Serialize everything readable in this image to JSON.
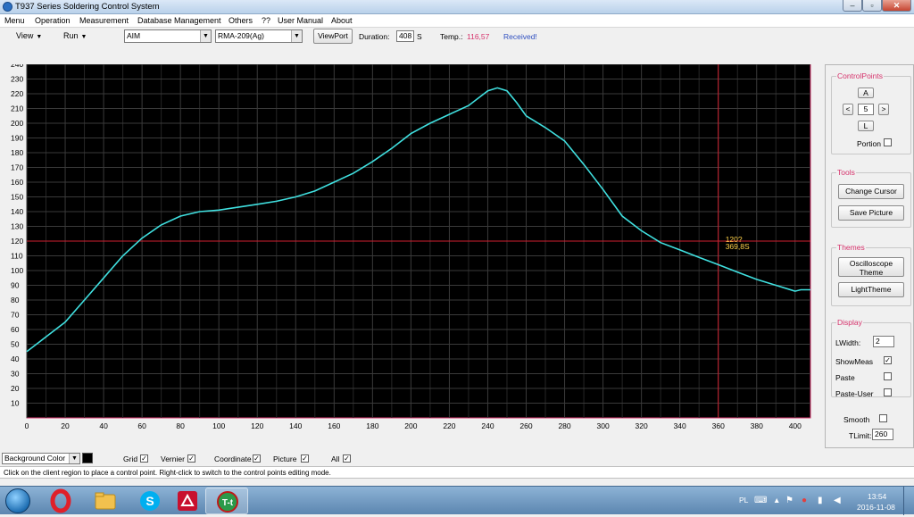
{
  "window": {
    "title": "T937 Series Soldering Control System",
    "min": "–",
    "max": "▫",
    "close": "✕"
  },
  "menu": [
    "Menu",
    "Operation",
    "Measurement",
    "Database Management",
    "Others",
    "??",
    "User Manual",
    "About"
  ],
  "toolbar": {
    "view_label": "View",
    "run_label": "Run",
    "mode_value": "AIM",
    "profile_value": "RMA-209(Ag)",
    "viewport_label": "ViewPort",
    "duration_label": "Duration:",
    "duration_value": "408",
    "duration_unit": "S",
    "temp_label": "Temp.:",
    "temp_value": "116,57",
    "status": "Received!"
  },
  "chart_data": {
    "type": "line",
    "xlim": [
      0,
      408
    ],
    "ylim": [
      0,
      240
    ],
    "xticks": [
      0,
      20,
      40,
      60,
      80,
      100,
      120,
      140,
      160,
      180,
      200,
      220,
      240,
      260,
      280,
      300,
      320,
      340,
      360,
      380,
      400
    ],
    "yticks": [
      10,
      20,
      30,
      40,
      50,
      60,
      70,
      80,
      90,
      100,
      110,
      120,
      130,
      140,
      150,
      160,
      170,
      180,
      190,
      200,
      210,
      220,
      230,
      240
    ],
    "grid": true,
    "background": "#000000",
    "line_color": "#40e0e0",
    "series": [
      {
        "x": [
          0,
          10,
          20,
          30,
          40,
          50,
          60,
          70,
          80,
          90,
          100,
          110,
          120,
          130,
          140,
          150,
          160,
          170,
          180,
          190,
          200,
          210,
          220,
          230,
          240,
          245,
          250,
          255,
          260,
          270,
          280,
          290,
          300,
          310,
          320,
          330,
          340,
          350,
          360,
          370,
          380,
          390,
          400,
          403,
          408
        ],
        "y": [
          45,
          55,
          65,
          80,
          95,
          110,
          122,
          131,
          137,
          140,
          141,
          143,
          145,
          147,
          150,
          154,
          160,
          166,
          174,
          183,
          193,
          200,
          206,
          212,
          222,
          224,
          222,
          214,
          205,
          197,
          188,
          172,
          155,
          137,
          127,
          119,
          114,
          109,
          104,
          99,
          94,
          90,
          86,
          87,
          87
        ]
      }
    ],
    "cursor": {
      "x": 360,
      "y": 120,
      "label_line1": "120?",
      "label_line2": "369,8S"
    },
    "cursor_color": "#d02030"
  },
  "panel": {
    "control_points_title": "ControlPoints",
    "cp_up": "A",
    "cp_down": "L",
    "cp_left": "<",
    "cp_right": ">",
    "cp_value": "5",
    "portion_label": "Portion",
    "tools_title": "Tools",
    "change_cursor": "Change Cursor",
    "save_picture": "Save Picture",
    "themes_title": "Themes",
    "osc_theme": "Oscilloscope Theme",
    "light_theme": "LightTheme",
    "display_title": "Display",
    "lwidth_label": "LWidth:",
    "lwidth_value": "2",
    "showmeas_label": "ShowMeas",
    "paste_label": "Paste",
    "paste_user_label": "Paste-User",
    "smooth_label": "Smooth",
    "tlimit_label": "TLimit:",
    "tlimit_value": "260"
  },
  "bottom": {
    "background_color_label": "Background Color",
    "grid_label": "Grid",
    "vernier_label": "Vernier",
    "coordinate_label": "Coordinate",
    "picture_label": "Picture",
    "all_label": "All"
  },
  "status_bar": "Click on the client region to place a control point. Right-click to switch to the control points editing mode.",
  "taskbar": {
    "lang": "PL",
    "time": "13:54",
    "date": "2016-11-08"
  }
}
